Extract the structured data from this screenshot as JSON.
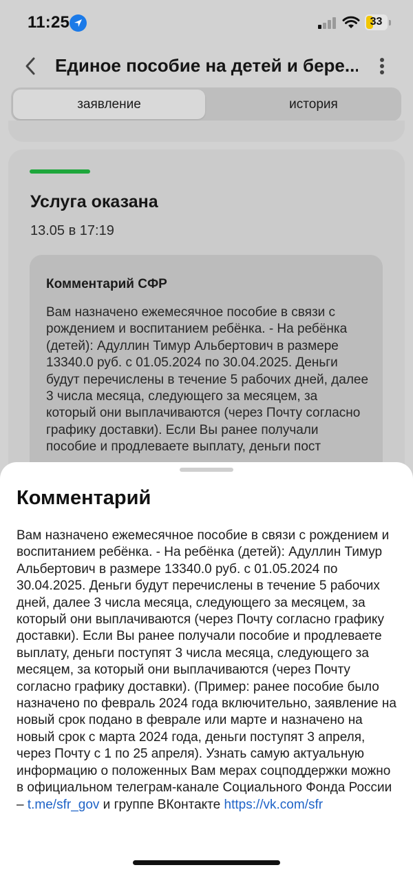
{
  "status_bar": {
    "time": "11:25",
    "battery": "33",
    "battery_level_percent": 33,
    "colors": {
      "battery_fill": "#f2c600",
      "location": "#1b7ae8"
    },
    "icons": [
      "location-arrow-icon",
      "cellular-signal-icon",
      "wifi-icon",
      "battery-icon"
    ]
  },
  "header": {
    "title": "Единое пособие на детей и бере...",
    "icons": [
      "back-chevron-icon",
      "more-vertical-icon"
    ]
  },
  "tabs": [
    {
      "label": "заявление",
      "active": true
    },
    {
      "label": "история",
      "active": false
    }
  ],
  "status_card": {
    "status": "Услуга оказана",
    "date": "13.05 в 17:19",
    "accent_color": "#1ea73c",
    "comment_title": "Комментарий СФР",
    "comment_preview": "Вам назначено ежемесячное пособие в связи с рождением и воспитанием ребёнка. - На ребёнка (детей): Адуллин Тимур Альбертович в размере 13340.0 руб. с 01.05.2024 по 30.04.2025. Деньги будут перечислены в течение 5 рабочих дней, далее 3 числа месяца, следующего за месяцем, за который они выплачиваются (через Почту согласно графику доставки). Если Вы ранее получали пособие и продлеваете выплату, деньги пост"
  },
  "sheet": {
    "title": "Комментарий",
    "text_main": "Вам назначено ежемесячное пособие в связи с рождением и воспитанием ребёнка. - На ребёнка (детей): Адуллин Тимур Альбертович в размере 13340.0 руб. с 01.05.2024 по 30.04.2025. Деньги будут перечислены в течение 5 рабочих дней, далее 3 числа месяца, следующего за месяцем, за который они выплачиваются (через Почту согласно графику доставки). Если Вы ранее получали пособие и продлеваете выплату, деньги поступят 3 числа месяца, следующего за месяцем, за который они выплачиваются (через Почту согласно графику доставки). (Пример: ранее пособие было назначено по февраль 2024 года включительно, заявление на новый срок подано в феврале или марте и назначено на новый срок с марта 2024 года, деньги поступят 3 апреля, через Почту с 1 по 25 апреля). Узнать самую актуальную информацию о положенных Вам мерах соцподдержки можно в официальном телеграм-канале Социального Фонда России – ",
    "link1": "t.me/sfr_gov",
    "text_between": " и группе ВКонтакте ",
    "link2": "https://vk.com/sfr",
    "link_color": "#1e63c7"
  }
}
